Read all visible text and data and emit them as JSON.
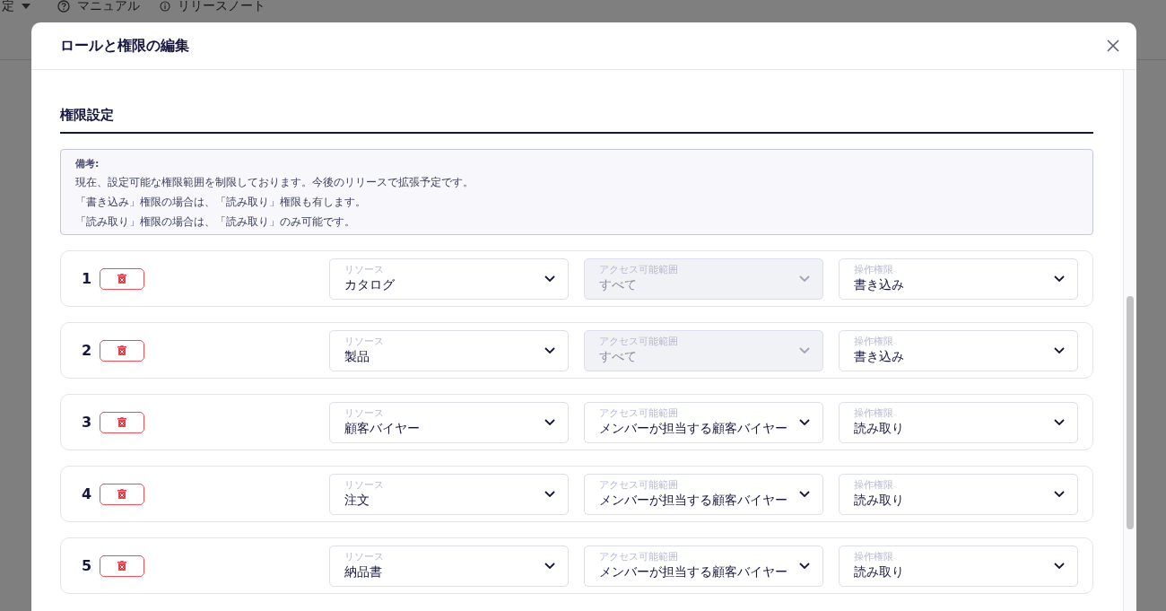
{
  "background_page": {
    "menu": [
      {
        "kind": "dropdown",
        "label": "定"
      },
      {
        "kind": "help",
        "label": "マニュアル"
      },
      {
        "kind": "info",
        "label": "リリースノート"
      }
    ]
  },
  "dialog": {
    "title": "ロールと権限の編集",
    "section_title": "権限設定",
    "note": {
      "heading": "備考:",
      "lines": [
        "現在、設定可能な権限範囲を制限しております。今後のリリースで拡張予定です。",
        "「書き込み」権限の場合は、「読み取り」権限も有します。",
        "「読み取り」権限の場合は、「読み取り」のみ可能です。"
      ]
    },
    "rows": [
      {
        "number": "1",
        "fields": [
          {
            "label": "リソース",
            "value": "カタログ",
            "disabled": false
          },
          {
            "label": "アクセス可能範囲",
            "value": "すべて",
            "disabled": true
          },
          {
            "label": "操作権限",
            "value": "書き込み",
            "disabled": false
          }
        ]
      },
      {
        "number": "2",
        "fields": [
          {
            "label": "リソース",
            "value": "製品",
            "disabled": false
          },
          {
            "label": "アクセス可能範囲",
            "value": "すべて",
            "disabled": true
          },
          {
            "label": "操作権限",
            "value": "書き込み",
            "disabled": false
          }
        ]
      },
      {
        "number": "3",
        "fields": [
          {
            "label": "リソース",
            "value": "顧客バイヤー",
            "disabled": false
          },
          {
            "label": "アクセス可能範囲",
            "value": "メンバーが担当する顧客バイヤー",
            "disabled": false
          },
          {
            "label": "操作権限",
            "value": "読み取り",
            "disabled": false
          }
        ]
      },
      {
        "number": "4",
        "fields": [
          {
            "label": "リソース",
            "value": "注文",
            "disabled": false
          },
          {
            "label": "アクセス可能範囲",
            "value": "メンバーが担当する顧客バイヤー",
            "disabled": false
          },
          {
            "label": "操作権限",
            "value": "読み取り",
            "disabled": false
          }
        ]
      },
      {
        "number": "5",
        "fields": [
          {
            "label": "リソース",
            "value": "納品書",
            "disabled": false
          },
          {
            "label": "アクセス可能範囲",
            "value": "メンバーが担当する顧客バイヤー",
            "disabled": false
          },
          {
            "label": "操作権限",
            "value": "読み取り",
            "disabled": false
          }
        ]
      }
    ]
  }
}
